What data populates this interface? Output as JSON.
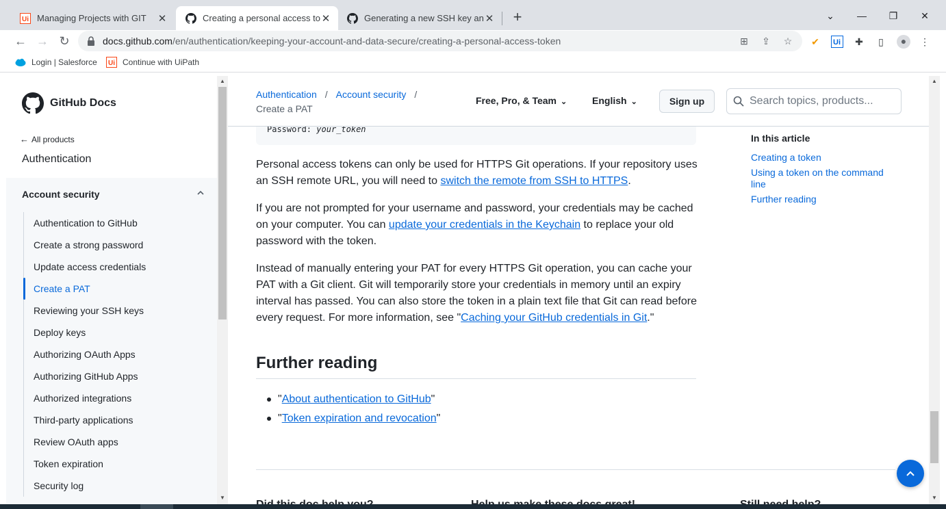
{
  "browser": {
    "tabs": [
      {
        "title": "Managing Projects with GIT",
        "active": false,
        "favicon": "uipath-icon"
      },
      {
        "title": "Creating a personal access token",
        "active": true,
        "favicon": "github-icon"
      },
      {
        "title": "Generating a new SSH key and add",
        "active": false,
        "favicon": "github-icon"
      }
    ],
    "new_tab_label": "+",
    "address": {
      "domain": "docs.github.com",
      "path": "/en/authentication/keeping-your-account-and-data-secure/creating-a-personal-access-token"
    },
    "bookmarks": [
      {
        "label": "Login | Salesforce",
        "icon": "salesforce-icon"
      },
      {
        "label": "Continue with UiPath",
        "icon": "uipath-icon"
      }
    ]
  },
  "sidebar": {
    "brand": "GitHub Docs",
    "all_products": "All products",
    "section": "Authentication",
    "group_title": "Account security",
    "items": [
      {
        "label": "Authentication to GitHub",
        "active": false
      },
      {
        "label": "Create a strong password",
        "active": false
      },
      {
        "label": "Update access credentials",
        "active": false
      },
      {
        "label": "Create a PAT",
        "active": true
      },
      {
        "label": "Reviewing your SSH keys",
        "active": false
      },
      {
        "label": "Deploy keys",
        "active": false
      },
      {
        "label": "Authorizing OAuth Apps",
        "active": false
      },
      {
        "label": "Authorizing GitHub Apps",
        "active": false
      },
      {
        "label": "Authorized integrations",
        "active": false
      },
      {
        "label": "Third-party applications",
        "active": false
      },
      {
        "label": "Review OAuth apps",
        "active": false
      },
      {
        "label": "Token expiration",
        "active": false
      },
      {
        "label": "Security log",
        "active": false
      }
    ]
  },
  "header": {
    "breadcrumbs": [
      "Authentication",
      "Account security"
    ],
    "breadcrumb_sep": "/",
    "current": "Create a PAT",
    "version": "Free, Pro, & Team",
    "language": "English",
    "signup": "Sign up",
    "search_placeholder": "Search topics, products..."
  },
  "content": {
    "code": {
      "label": "Password:",
      "value": "your_token"
    },
    "p1": {
      "before": "Personal access tokens can only be used for HTTPS Git operations. If your repository uses an SSH remote URL, you will need to ",
      "link": "switch the remote from SSH to HTTPS",
      "after": "."
    },
    "p2": {
      "before": "If you are not prompted for your username and password, your credentials may be cached on your computer. You can ",
      "link": "update your credentials in the Keychain",
      "after": " to replace your old password with the token."
    },
    "p3": {
      "before": "Instead of manually entering your PAT for every HTTPS Git operation, you can cache your PAT with a Git client. Git will temporarily store your credentials in memory until an expiry interval has passed. You can also store the token in a plain text file that Git can read before every request. For more information, see \"",
      "link": "Caching your GitHub credentials in Git",
      "after": ".\""
    },
    "further_reading_title": "Further reading",
    "further_reading": [
      "About authentication to GitHub",
      "Token expiration and revocation"
    ],
    "quote_open": "\"",
    "quote_close": "\"",
    "footer_peek": [
      "Did this doc help you?",
      "Help us make these docs great!",
      "Still need help?"
    ]
  },
  "toc": {
    "title": "In this article",
    "links": [
      "Creating a token",
      "Using a token on the command line",
      "Further reading"
    ]
  },
  "colors": {
    "accent": "#0969da",
    "text": "#1f2328",
    "muted": "#57606a",
    "border": "#d0d7de",
    "sidebar_bg": "#f6f8fa"
  }
}
